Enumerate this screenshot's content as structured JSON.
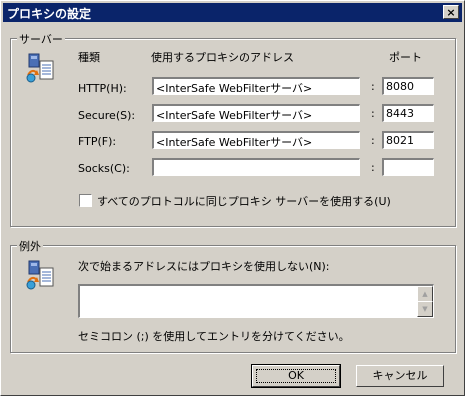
{
  "window": {
    "title": "プロキシの設定",
    "close_glyph": "×"
  },
  "servers": {
    "legend": "サーバー",
    "col_type": "種類",
    "col_address": "使用するプロキシのアドレス",
    "col_port": "ポート",
    "rows": [
      {
        "label": "HTTP(H):",
        "address": "<InterSafe WebFilterサーバ>",
        "port": "8080"
      },
      {
        "label": "Secure(S):",
        "address": "<InterSafe WebFilterサーバ>",
        "port": "8443"
      },
      {
        "label": "FTP(F):",
        "address": "<InterSafe WebFilterサーバ>",
        "port": "8021"
      },
      {
        "label": "Socks(C):",
        "address": "",
        "port": ""
      }
    ],
    "colon": ":",
    "same_proxy_label": "すべてのプロトコルに同じプロキシ サーバーを使用する(U)",
    "same_proxy_checked": false
  },
  "exceptions": {
    "legend": "例外",
    "instruction": "次で始まるアドレスにはプロキシを使用しない(N):",
    "value": "",
    "note": "セミコロン (;) を使用してエントリを分けてください。"
  },
  "buttons": {
    "ok": "OK",
    "cancel": "キャンセル"
  },
  "colors": {
    "title_bar": "#0a246a",
    "dialog_bg": "#d4d0c8"
  }
}
